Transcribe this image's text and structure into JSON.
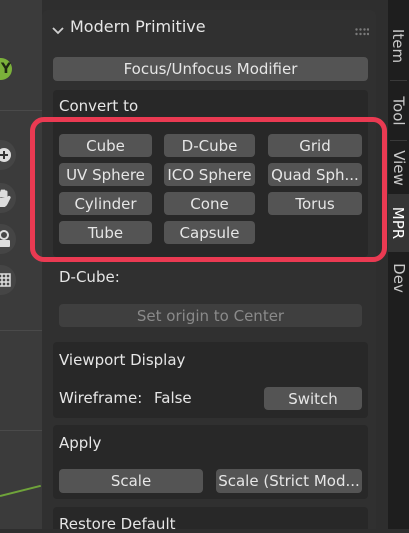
{
  "panel": {
    "title": "Modern Primitive",
    "focus_button": "Focus/Unfocus Modifier"
  },
  "convert": {
    "heading": "Convert to",
    "buttons": [
      "Cube",
      "D-Cube",
      "Grid",
      "UV Sphere",
      "ICO Sphere",
      "Quad Sph...",
      "Cylinder",
      "Cone",
      "Torus",
      "Tube",
      "Capsule"
    ]
  },
  "dcube": {
    "label": "D-Cube:",
    "origin_button": "Set origin to Center"
  },
  "viewport_display": {
    "heading": "Viewport Display",
    "wireframe_label": "Wireframe:",
    "wireframe_value": "False",
    "switch_button": "Switch"
  },
  "apply": {
    "heading": "Apply",
    "scale_button": "Scale",
    "scale_strict_button": "Scale (Strict Mod..."
  },
  "restore": {
    "heading": "Restore Default"
  },
  "tabs": [
    "Item",
    "Tool",
    "View",
    "MPR",
    "Dev"
  ],
  "active_tab": "MPR",
  "viewport": {
    "axis_label": "Y"
  },
  "colors": {
    "highlight": "#ea3a52",
    "button": "#545454",
    "panel": "#303030",
    "axis_y": "#7bb13a"
  }
}
